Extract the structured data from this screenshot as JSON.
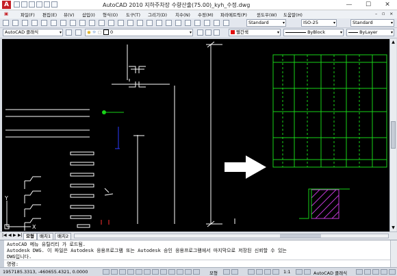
{
  "window": {
    "title": "AutoCAD 2010    지하주차장 수량산출(75.00)_kyh_수정.dwg",
    "logo_letter": "A",
    "minimize": "—",
    "maximize": "☐",
    "close": "✕"
  },
  "menu": [
    "파일(F)",
    "편집(E)",
    "뷰(V)",
    "삽입(I)",
    "형식(O)",
    "도구(T)",
    "그리기(D)",
    "치수(N)",
    "수정(M)",
    "파라메트릭(P)",
    "윈도우(W)",
    "도움말(H)"
  ],
  "toolbar_standard": {
    "text_style": "Standard",
    "dim_style": "ISO-25",
    "table_style": "Standard"
  },
  "toolbar_layers": {
    "workspace": "AutoCAD 클래식",
    "layer": "0",
    "color": "빨간색",
    "linetype": "ByBlock",
    "lineweight": "ByLayer"
  },
  "ucs": {
    "x_label": "X",
    "y_label": "Y"
  },
  "layout_tabs": [
    "모형",
    "배치1",
    "배치2"
  ],
  "tab_nav": [
    "|◀",
    "◀",
    "▶",
    "▶|"
  ],
  "command": {
    "lines": [
      "AutoCAD 메뉴 유틸리티 가 로드됨.",
      "Autodesk DWG.  이 파일은 Autodesk 응용프로그램 또는 Autodesk 승인 응용프로그램에서 마지막으로 저장된 신뢰할 수 있는",
      "DWG입니다."
    ],
    "prompt": "명령:"
  },
  "status": {
    "coordinates": "1957185.3313, -460655.4321, 0.0000",
    "model_label": "모형",
    "scale": "1:1",
    "workspace": "AutoCAD 클래식"
  },
  "colors": {
    "canvas": "#000000",
    "drawing_white": "#ffffff",
    "grid_green": "#19d419",
    "hatch_magenta": "#c23ad6",
    "ucs_blue": "#2b3cff"
  }
}
